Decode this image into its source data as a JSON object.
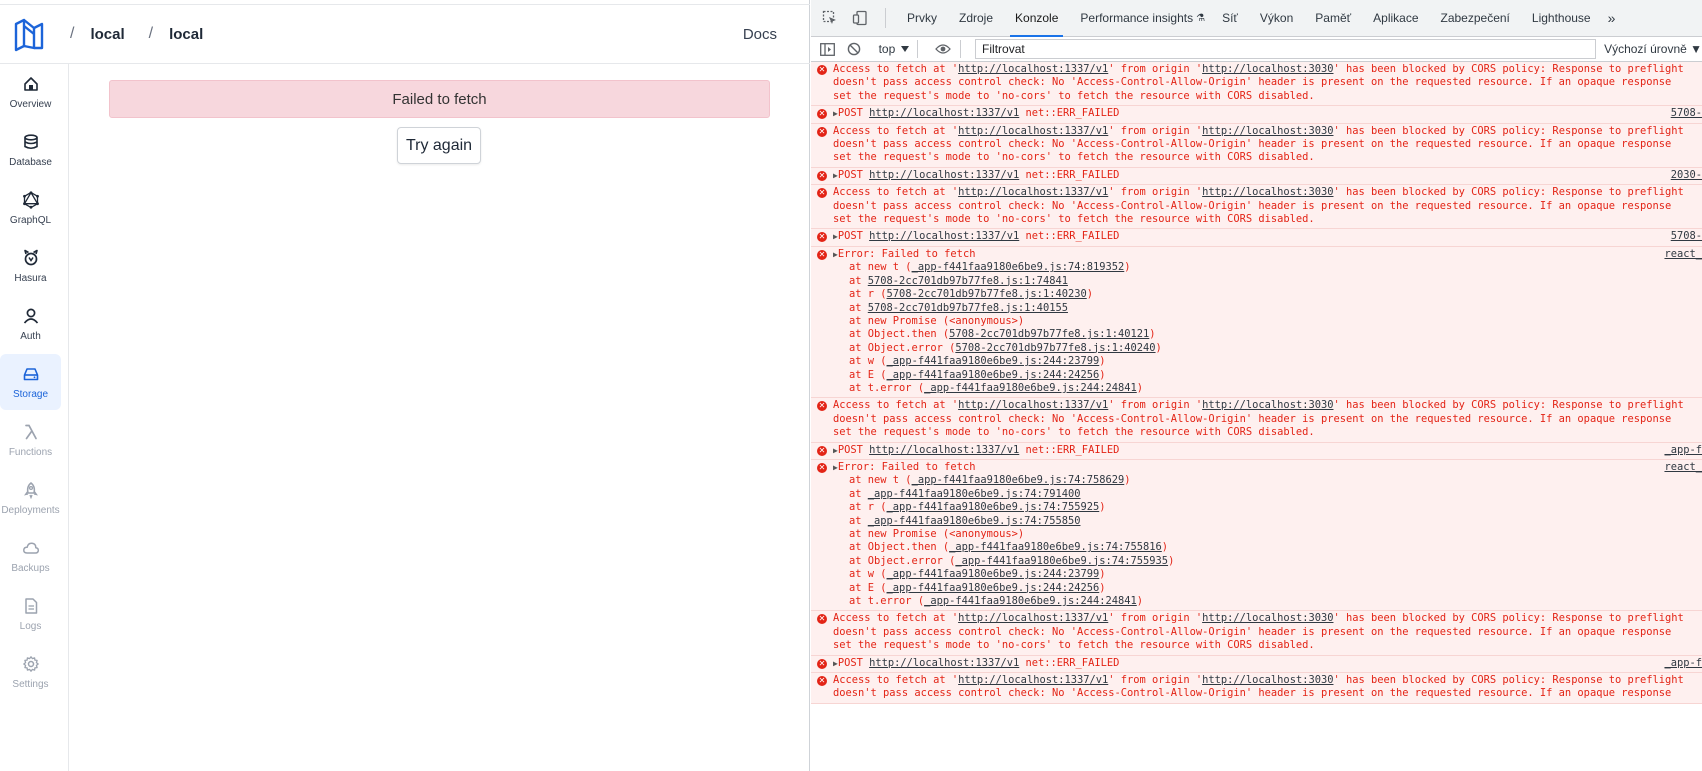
{
  "app": {
    "breadcrumb": [
      "local",
      "local"
    ],
    "breadcrumb_separator": "/",
    "docs_label": "Docs",
    "error_message": "Failed to fetch",
    "try_again_label": "Try again",
    "brand_color": "#1c64d9",
    "nav": [
      {
        "label": "Overview",
        "icon": "home-icon",
        "state": "normal"
      },
      {
        "label": "Database",
        "icon": "database-icon",
        "state": "normal"
      },
      {
        "label": "GraphQL",
        "icon": "graphql-icon",
        "state": "normal"
      },
      {
        "label": "Hasura",
        "icon": "hasura-icon",
        "state": "normal"
      },
      {
        "label": "Auth",
        "icon": "user-icon",
        "state": "normal"
      },
      {
        "label": "Storage",
        "icon": "storage-icon",
        "state": "active"
      },
      {
        "label": "Functions",
        "icon": "lambda-icon",
        "state": "muted"
      },
      {
        "label": "Deployments",
        "icon": "rocket-icon",
        "state": "muted"
      },
      {
        "label": "Backups",
        "icon": "cloud-icon",
        "state": "muted"
      },
      {
        "label": "Logs",
        "icon": "document-icon",
        "state": "muted"
      },
      {
        "label": "Settings",
        "icon": "gear-icon",
        "state": "muted"
      }
    ]
  },
  "devtools": {
    "tabs": [
      "Prvky",
      "Zdroje",
      "Konzole",
      "Performance insights",
      "Síť",
      "Výkon",
      "Paměť",
      "Aplikace",
      "Zabezpečení",
      "Lighthouse"
    ],
    "active_tab": "Konzole",
    "more_tabs": "»",
    "context": "top",
    "filter_placeholder": "Filtrovat",
    "levels": "Výchozí úrovně ▼",
    "error_color": "#e32416",
    "messages": [
      {
        "kind": "cors",
        "lines": [
          "Access to fetch at 'http://localhost:1337/v1' from origin 'http://localhost:3030' has been blocked by CORS policy: Response to preflight",
          "doesn't pass access control check: No 'Access-Control-Allow-Origin' header is present on the requested resource. If an opaque response",
          "set the request's mode to 'no-cors' to fetch the resource with CORS disabled."
        ],
        "source": ""
      },
      {
        "kind": "post",
        "lines": [
          "POST http://localhost:1337/v1 net::ERR_FAILED"
        ],
        "source": "5708-"
      },
      {
        "kind": "cors",
        "lines": [
          "Access to fetch at 'http://localhost:1337/v1' from origin 'http://localhost:3030' has been blocked by CORS policy: Response to preflight",
          "doesn't pass access control check: No 'Access-Control-Allow-Origin' header is present on the requested resource. If an opaque response",
          "set the request's mode to 'no-cors' to fetch the resource with CORS disabled."
        ],
        "source": ""
      },
      {
        "kind": "post",
        "lines": [
          "POST http://localhost:1337/v1 net::ERR_FAILED"
        ],
        "source": "2030-"
      },
      {
        "kind": "cors",
        "lines": [
          "Access to fetch at 'http://localhost:1337/v1' from origin 'http://localhost:3030' has been blocked by CORS policy: Response to preflight",
          "doesn't pass access control check: No 'Access-Control-Allow-Origin' header is present on the requested resource. If an opaque response",
          "set the request's mode to 'no-cors' to fetch the resource with CORS disabled."
        ],
        "source": ""
      },
      {
        "kind": "post",
        "lines": [
          "POST http://localhost:1337/v1 net::ERR_FAILED"
        ],
        "source": "5708-"
      },
      {
        "kind": "error",
        "lines": [
          "Error: Failed to fetch",
          "at new t (_app-f441faa9180e6be9.js:74:819352)",
          "at 5708-2cc701db97b77fe8.js:1:74841",
          "at r (5708-2cc701db97b77fe8.js:1:40230)",
          "at 5708-2cc701db97b77fe8.js:1:40155",
          "at new Promise (<anonymous>)",
          "at Object.then (5708-2cc701db97b77fe8.js:1:40121)",
          "at Object.error (5708-2cc701db97b77fe8.js:1:40240)",
          "at w (_app-f441faa9180e6be9.js:244:23799)",
          "at E (_app-f441faa9180e6be9.js:244:24256)",
          "at t.error (_app-f441faa9180e6be9.js:244:24841)"
        ],
        "source": "react_"
      },
      {
        "kind": "cors",
        "lines": [
          "Access to fetch at 'http://localhost:1337/v1' from origin 'http://localhost:3030' has been blocked by CORS policy: Response to preflight",
          "doesn't pass access control check: No 'Access-Control-Allow-Origin' header is present on the requested resource. If an opaque response",
          "set the request's mode to 'no-cors' to fetch the resource with CORS disabled."
        ],
        "source": ""
      },
      {
        "kind": "post",
        "lines": [
          "POST http://localhost:1337/v1 net::ERR_FAILED"
        ],
        "source": "_app-f"
      },
      {
        "kind": "error",
        "lines": [
          "Error: Failed to fetch",
          "at new t (_app-f441faa9180e6be9.js:74:758629)",
          "at _app-f441faa9180e6be9.js:74:791400",
          "at r (_app-f441faa9180e6be9.js:74:755925)",
          "at _app-f441faa9180e6be9.js:74:755850",
          "at new Promise (<anonymous>)",
          "at Object.then (_app-f441faa9180e6be9.js:74:755816)",
          "at Object.error (_app-f441faa9180e6be9.js:74:755935)",
          "at w (_app-f441faa9180e6be9.js:244:23799)",
          "at E (_app-f441faa9180e6be9.js:244:24256)",
          "at t.error (_app-f441faa9180e6be9.js:244:24841)"
        ],
        "source": "react_"
      },
      {
        "kind": "cors",
        "lines": [
          "Access to fetch at 'http://localhost:1337/v1' from origin 'http://localhost:3030' has been blocked by CORS policy: Response to preflight",
          "doesn't pass access control check: No 'Access-Control-Allow-Origin' header is present on the requested resource. If an opaque response",
          "set the request's mode to 'no-cors' to fetch the resource with CORS disabled."
        ],
        "source": ""
      },
      {
        "kind": "post",
        "lines": [
          "POST http://localhost:1337/v1 net::ERR_FAILED"
        ],
        "source": "_app-f"
      },
      {
        "kind": "cors",
        "lines": [
          "Access to fetch at 'http://localhost:1337/v1' from origin 'http://localhost:3030' has been blocked by CORS policy: Response to preflight",
          "doesn't pass access control check: No 'Access-Control-Allow-Origin' header is present on the requested resource. If an opaque response"
        ],
        "source": ""
      }
    ]
  }
}
